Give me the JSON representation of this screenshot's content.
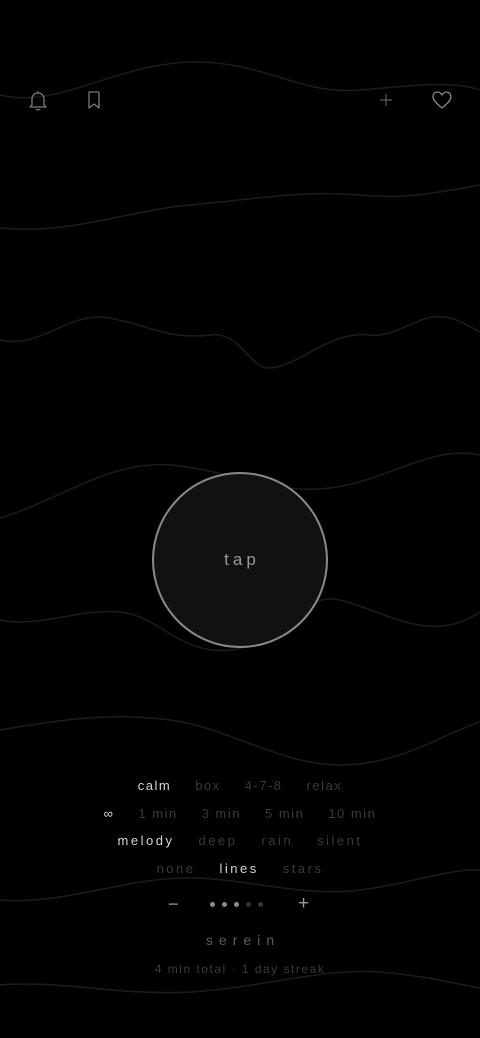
{
  "colors": {
    "background": "#000000",
    "wave": "#1a1a1a",
    "active_text": "#d6d6d6",
    "inactive_text": "#3a3a3a",
    "circle_border": "#8a8a8a"
  },
  "topbar": {
    "left_icons": [
      "bell-icon",
      "bookmark-icon"
    ],
    "right_icons": [
      "plus-icon",
      "heart-icon"
    ]
  },
  "breath_button": {
    "label": "tap"
  },
  "pattern": {
    "options": [
      "calm",
      "box",
      "4-7-8",
      "relax"
    ],
    "selected": "calm"
  },
  "duration": {
    "options": [
      "∞",
      "1 min",
      "3 min",
      "5 min",
      "10 min"
    ],
    "selected": "∞"
  },
  "sound": {
    "options": [
      "melody",
      "deep",
      "rain",
      "silent"
    ],
    "selected": "melody"
  },
  "visual": {
    "options": [
      "none",
      "lines",
      "stars"
    ],
    "selected": "lines"
  },
  "volume": {
    "decrease_label": "−",
    "increase_label": "+",
    "level": 3,
    "steps": 5
  },
  "footer": {
    "app_name": "serein",
    "stats": "4 min total · 1 day streak"
  }
}
